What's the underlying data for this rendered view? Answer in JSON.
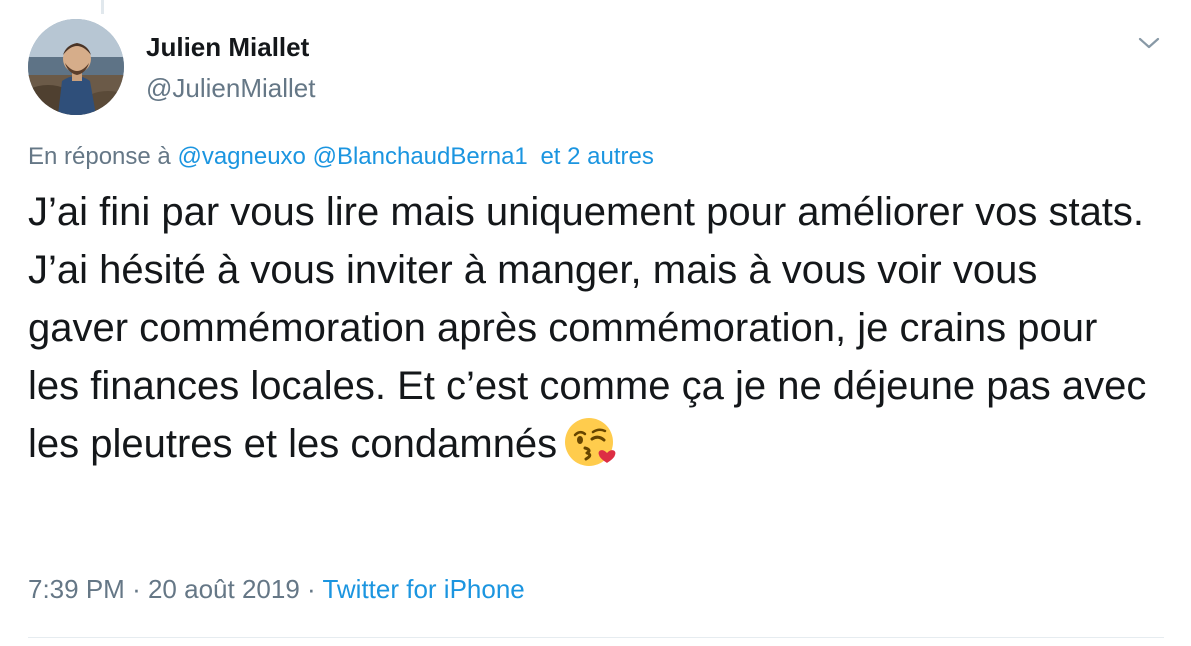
{
  "tweet": {
    "author": {
      "name": "Julien Miallet",
      "handle": "@JulienMiallet"
    },
    "reply": {
      "prefix": "En réponse à",
      "mentions": [
        "@vagneuxo",
        "@BlanchaudBerna1"
      ],
      "others": "et 2 autres"
    },
    "text": "J’ai fini par vous lire mais uniquement pour améliorer vos stats. J’ai hésité à vous inviter à manger, mais à vous voir vous gaver commémoration après commémoration, je crains pour les finances locales. Et c’est comme ça je ne déjeune pas avec les pleutres et les condamnés",
    "emoji": "face-blowing-a-kiss",
    "time": "7:39 PM",
    "separator": "·",
    "date": "20 août 2019",
    "source": "Twitter for iPhone",
    "menu_icon": "chevron-down-icon"
  },
  "colors": {
    "name_text": "#14171a",
    "secondary_text": "#657786",
    "link": "#1b95e0",
    "divider": "#e6ecf0"
  }
}
